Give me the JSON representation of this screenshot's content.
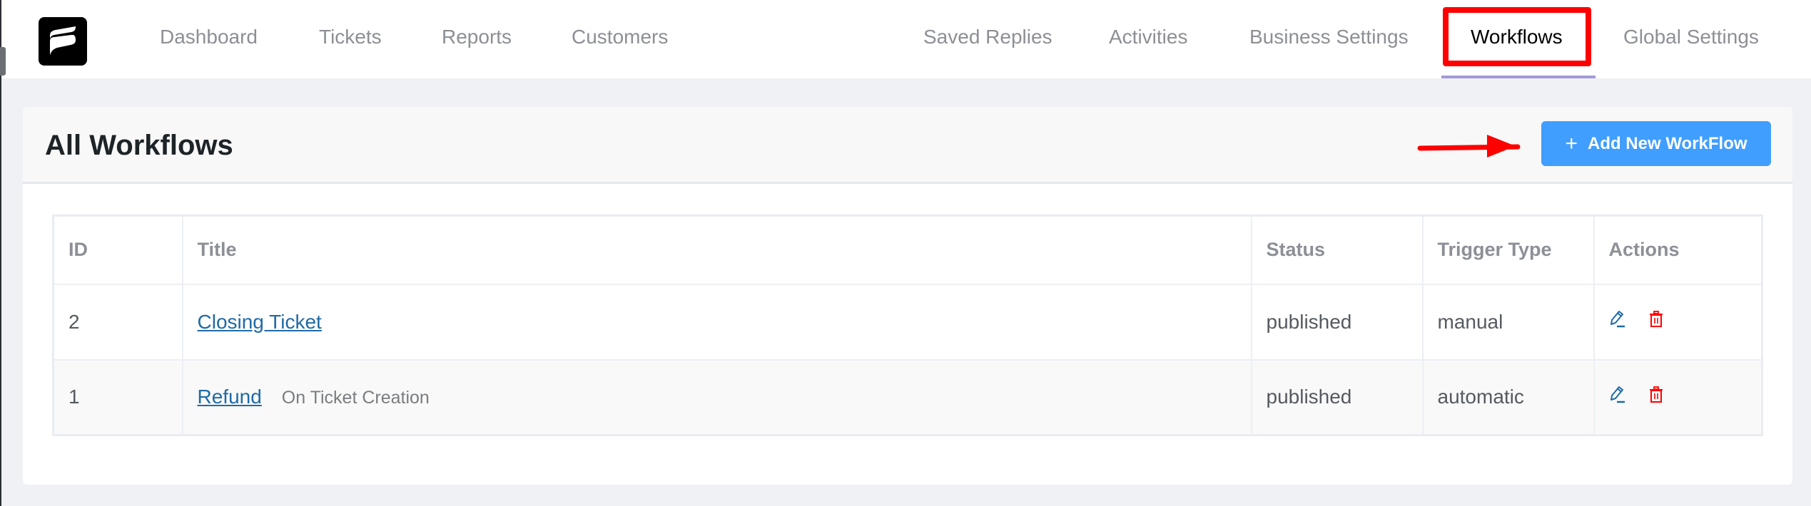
{
  "nav": {
    "left": [
      {
        "label": "Dashboard"
      },
      {
        "label": "Tickets"
      },
      {
        "label": "Reports"
      },
      {
        "label": "Customers"
      }
    ],
    "right": [
      {
        "label": "Saved Replies"
      },
      {
        "label": "Activities"
      },
      {
        "label": "Business Settings"
      },
      {
        "label": "Workflows",
        "active": true
      },
      {
        "label": "Global Settings"
      }
    ]
  },
  "page": {
    "title": "All Workflows",
    "add_button_label": "Add New WorkFlow",
    "add_button_icon": "plus-icon"
  },
  "colors": {
    "primary": "#409eff",
    "link": "#1f6aa5",
    "annotation": "#ff0000",
    "active_underline": "#a29bd8",
    "delete": "#ff0000"
  },
  "table": {
    "columns": [
      "ID",
      "Title",
      "Status",
      "Trigger Type",
      "Actions"
    ],
    "rows": [
      {
        "id": "2",
        "title": "Closing Ticket",
        "subtitle": "",
        "status": "published",
        "trigger_type": "manual",
        "actions": [
          "edit-icon",
          "delete-icon"
        ]
      },
      {
        "id": "1",
        "title": "Refund",
        "subtitle": "On Ticket Creation",
        "status": "published",
        "trigger_type": "automatic",
        "actions": [
          "edit-icon",
          "delete-icon"
        ]
      }
    ]
  }
}
